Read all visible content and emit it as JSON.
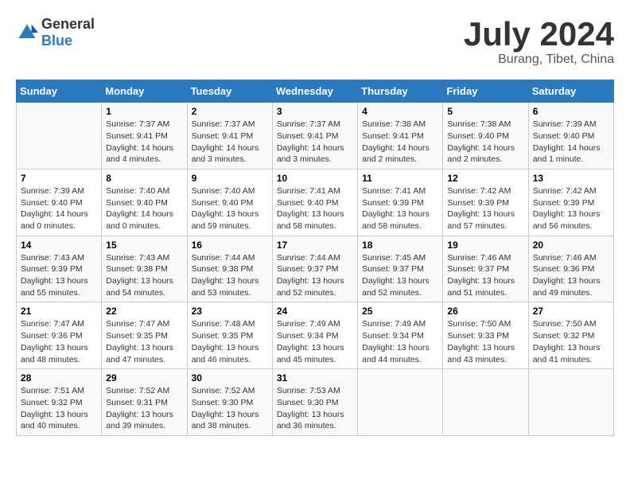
{
  "header": {
    "logo_general": "General",
    "logo_blue": "Blue",
    "title": "July 2024",
    "subtitle": "Burang, Tibet, China"
  },
  "calendar": {
    "weekdays": [
      "Sunday",
      "Monday",
      "Tuesday",
      "Wednesday",
      "Thursday",
      "Friday",
      "Saturday"
    ],
    "weeks": [
      [
        {
          "day": "",
          "info": ""
        },
        {
          "day": "1",
          "info": "Sunrise: 7:37 AM\nSunset: 9:41 PM\nDaylight: 14 hours\nand 4 minutes."
        },
        {
          "day": "2",
          "info": "Sunrise: 7:37 AM\nSunset: 9:41 PM\nDaylight: 14 hours\nand 3 minutes."
        },
        {
          "day": "3",
          "info": "Sunrise: 7:37 AM\nSunset: 9:41 PM\nDaylight: 14 hours\nand 3 minutes."
        },
        {
          "day": "4",
          "info": "Sunrise: 7:38 AM\nSunset: 9:41 PM\nDaylight: 14 hours\nand 2 minutes."
        },
        {
          "day": "5",
          "info": "Sunrise: 7:38 AM\nSunset: 9:40 PM\nDaylight: 14 hours\nand 2 minutes."
        },
        {
          "day": "6",
          "info": "Sunrise: 7:39 AM\nSunset: 9:40 PM\nDaylight: 14 hours\nand 1 minute."
        }
      ],
      [
        {
          "day": "7",
          "info": "Sunrise: 7:39 AM\nSunset: 9:40 PM\nDaylight: 14 hours\nand 0 minutes."
        },
        {
          "day": "8",
          "info": "Sunrise: 7:40 AM\nSunset: 9:40 PM\nDaylight: 14 hours\nand 0 minutes."
        },
        {
          "day": "9",
          "info": "Sunrise: 7:40 AM\nSunset: 9:40 PM\nDaylight: 13 hours\nand 59 minutes."
        },
        {
          "day": "10",
          "info": "Sunrise: 7:41 AM\nSunset: 9:40 PM\nDaylight: 13 hours\nand 58 minutes."
        },
        {
          "day": "11",
          "info": "Sunrise: 7:41 AM\nSunset: 9:39 PM\nDaylight: 13 hours\nand 58 minutes."
        },
        {
          "day": "12",
          "info": "Sunrise: 7:42 AM\nSunset: 9:39 PM\nDaylight: 13 hours\nand 57 minutes."
        },
        {
          "day": "13",
          "info": "Sunrise: 7:42 AM\nSunset: 9:39 PM\nDaylight: 13 hours\nand 56 minutes."
        }
      ],
      [
        {
          "day": "14",
          "info": "Sunrise: 7:43 AM\nSunset: 9:39 PM\nDaylight: 13 hours\nand 55 minutes."
        },
        {
          "day": "15",
          "info": "Sunrise: 7:43 AM\nSunset: 9:38 PM\nDaylight: 13 hours\nand 54 minutes."
        },
        {
          "day": "16",
          "info": "Sunrise: 7:44 AM\nSunset: 9:38 PM\nDaylight: 13 hours\nand 53 minutes."
        },
        {
          "day": "17",
          "info": "Sunrise: 7:44 AM\nSunset: 9:37 PM\nDaylight: 13 hours\nand 52 minutes."
        },
        {
          "day": "18",
          "info": "Sunrise: 7:45 AM\nSunset: 9:37 PM\nDaylight: 13 hours\nand 52 minutes."
        },
        {
          "day": "19",
          "info": "Sunrise: 7:46 AM\nSunset: 9:37 PM\nDaylight: 13 hours\nand 51 minutes."
        },
        {
          "day": "20",
          "info": "Sunrise: 7:46 AM\nSunset: 9:36 PM\nDaylight: 13 hours\nand 49 minutes."
        }
      ],
      [
        {
          "day": "21",
          "info": "Sunrise: 7:47 AM\nSunset: 9:36 PM\nDaylight: 13 hours\nand 48 minutes."
        },
        {
          "day": "22",
          "info": "Sunrise: 7:47 AM\nSunset: 9:35 PM\nDaylight: 13 hours\nand 47 minutes."
        },
        {
          "day": "23",
          "info": "Sunrise: 7:48 AM\nSunset: 9:35 PM\nDaylight: 13 hours\nand 46 minutes."
        },
        {
          "day": "24",
          "info": "Sunrise: 7:49 AM\nSunset: 9:34 PM\nDaylight: 13 hours\nand 45 minutes."
        },
        {
          "day": "25",
          "info": "Sunrise: 7:49 AM\nSunset: 9:34 PM\nDaylight: 13 hours\nand 44 minutes."
        },
        {
          "day": "26",
          "info": "Sunrise: 7:50 AM\nSunset: 9:33 PM\nDaylight: 13 hours\nand 43 minutes."
        },
        {
          "day": "27",
          "info": "Sunrise: 7:50 AM\nSunset: 9:32 PM\nDaylight: 13 hours\nand 41 minutes."
        }
      ],
      [
        {
          "day": "28",
          "info": "Sunrise: 7:51 AM\nSunset: 9:32 PM\nDaylight: 13 hours\nand 40 minutes."
        },
        {
          "day": "29",
          "info": "Sunrise: 7:52 AM\nSunset: 9:31 PM\nDaylight: 13 hours\nand 39 minutes."
        },
        {
          "day": "30",
          "info": "Sunrise: 7:52 AM\nSunset: 9:30 PM\nDaylight: 13 hours\nand 38 minutes."
        },
        {
          "day": "31",
          "info": "Sunrise: 7:53 AM\nSunset: 9:30 PM\nDaylight: 13 hours\nand 36 minutes."
        },
        {
          "day": "",
          "info": ""
        },
        {
          "day": "",
          "info": ""
        },
        {
          "day": "",
          "info": ""
        }
      ]
    ]
  }
}
